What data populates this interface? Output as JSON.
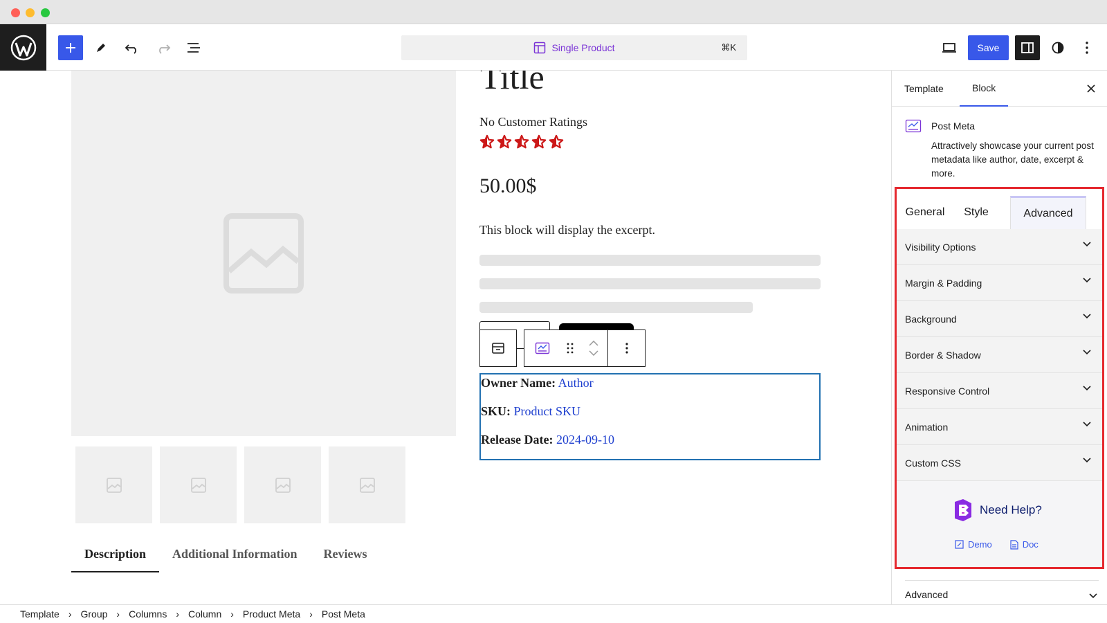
{
  "header": {
    "command_bar_title": "Single Product",
    "command_bar_shortcut": "⌘K",
    "save_label": "Save",
    "accent_color": "#3858e9"
  },
  "canvas": {
    "product_title": "Title",
    "ratings_text": "No Customer Ratings",
    "star_count": 5,
    "star_color": "#cc1818",
    "price": "50.00$",
    "excerpt": "This block will display the excerpt.",
    "meta": [
      {
        "label": "Owner Name:",
        "value": "Author"
      },
      {
        "label": "SKU:",
        "value": "Product SKU"
      },
      {
        "label": "Release Date:",
        "value": "2024-09-10"
      }
    ],
    "product_tabs": [
      "Description",
      "Additional Information",
      "Reviews"
    ]
  },
  "sidebar": {
    "tabs": [
      "Template",
      "Block"
    ],
    "block_name": "Post Meta",
    "block_description": "Attractively showcase your current post metadata like author, date, excerpt & more.",
    "panel_tabs": [
      "General",
      "Style",
      "Advanced"
    ],
    "accordion": [
      "Visibility Options",
      "Margin & Padding",
      "Background",
      "Border & Shadow",
      "Responsive Control",
      "Animation",
      "Custom CSS"
    ],
    "help_title": "Need Help?",
    "help_links": [
      "Demo",
      "Doc"
    ],
    "bottom_section": "Advanced",
    "highlight_color": "#e5292f"
  },
  "breadcrumb": [
    "Template",
    "Group",
    "Columns",
    "Column",
    "Product Meta",
    "Post Meta"
  ]
}
